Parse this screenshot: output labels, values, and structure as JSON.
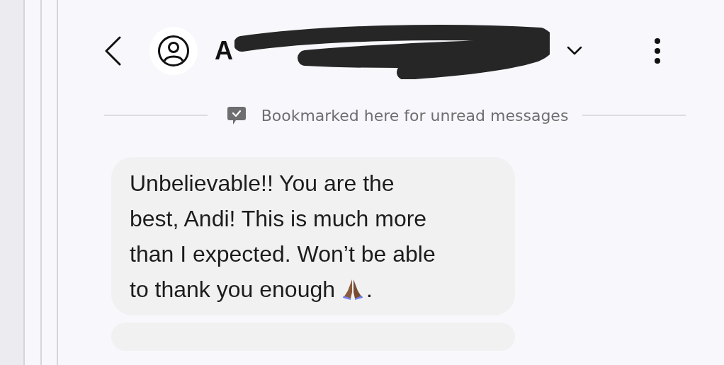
{
  "header": {
    "title": "A",
    "redacted": true
  },
  "divider": {
    "text": "Bookmarked here for unread messages"
  },
  "messages": [
    {
      "lines": [
        "Unbelievable!! You are the",
        "best, Andi! This is much more",
        "than I expected. Won’t be able",
        "to thank you enough"
      ],
      "trailing": "."
    }
  ]
}
